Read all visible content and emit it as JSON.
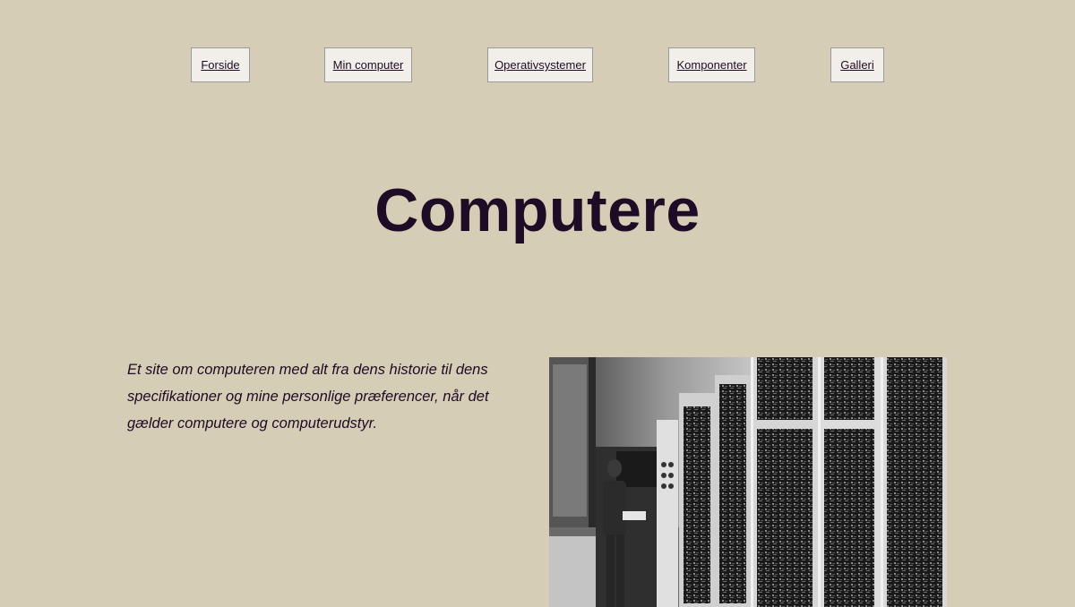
{
  "nav": {
    "items": [
      {
        "label": "Forside"
      },
      {
        "label": "Min computer"
      },
      {
        "label": "Operativsystemer"
      },
      {
        "label": "Komponenter"
      },
      {
        "label": "Galleri"
      }
    ]
  },
  "hero": {
    "title": "Computere"
  },
  "intro": {
    "text": "Et site om computeren med alt fra dens historie til dens specifikationer og mine personlige præferencer, når det gælder computere og computerudstyr."
  },
  "photo": {
    "icon": "vintage-computer-photo"
  },
  "colors": {
    "background": "#d5cdb5",
    "text": "#1e0b25",
    "nav_button_bg": "#f2efea",
    "nav_button_border": "#9a9a9a"
  }
}
